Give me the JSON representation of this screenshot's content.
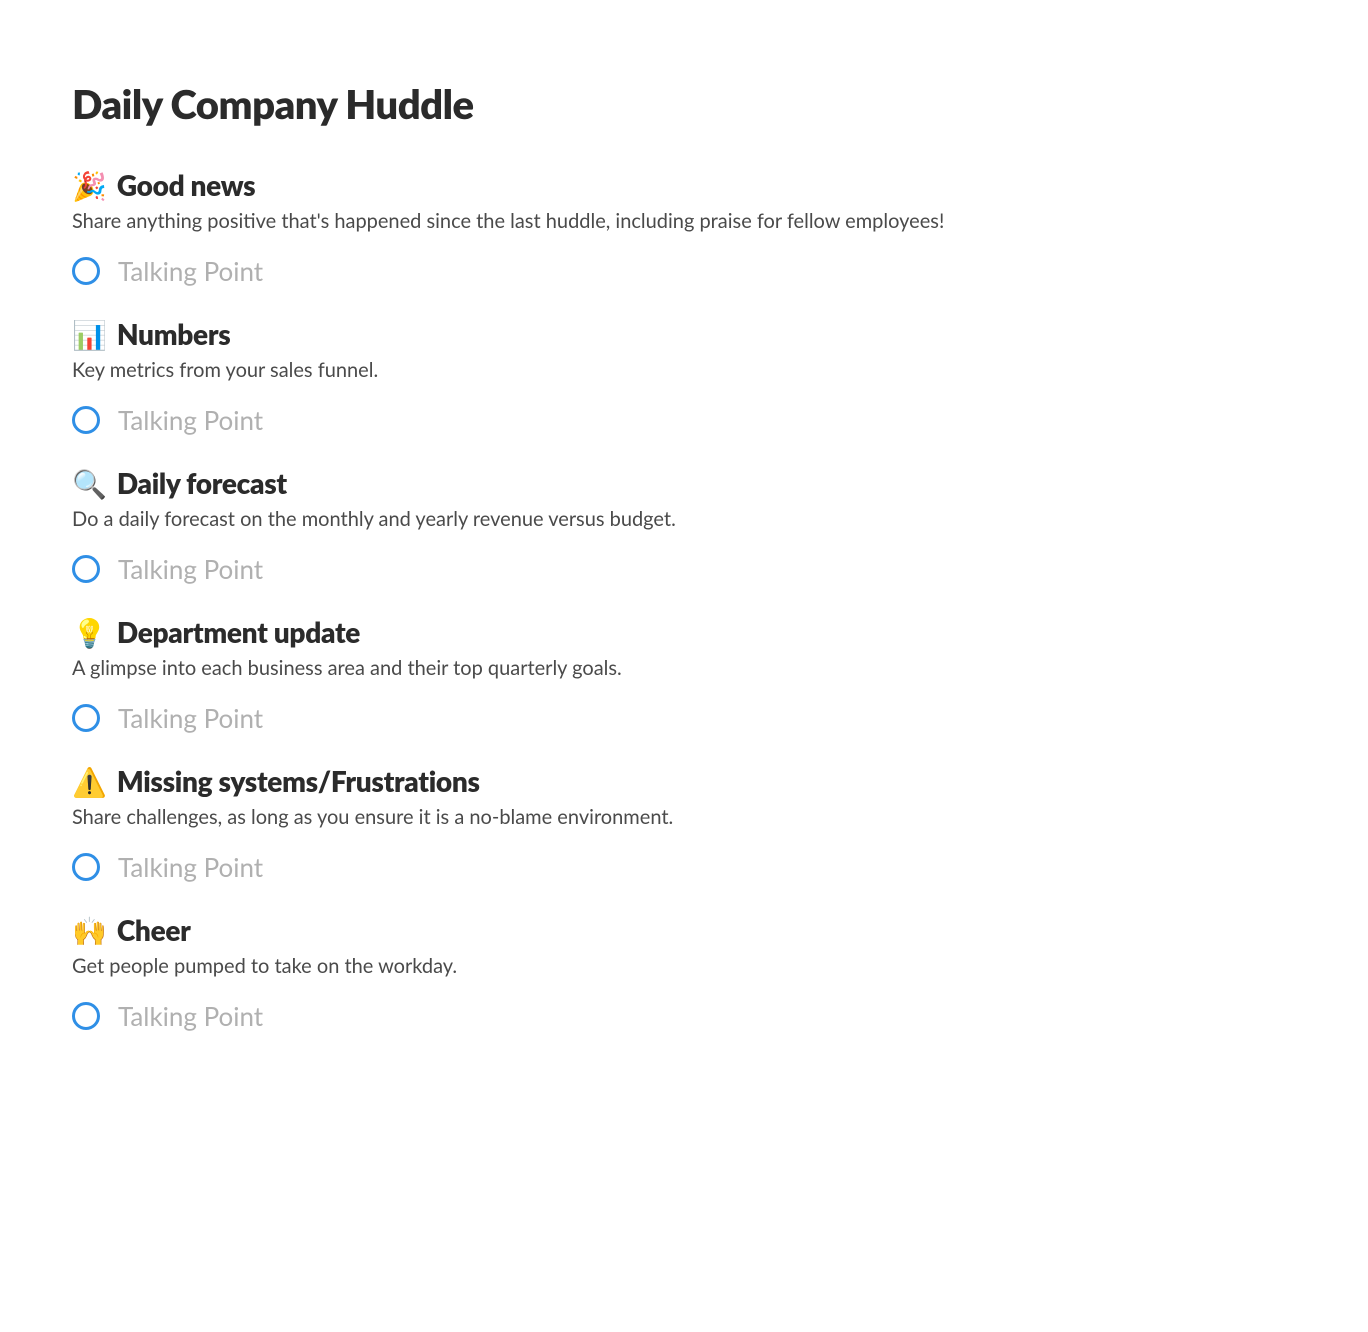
{
  "title": "Daily Company Huddle",
  "talking_point_placeholder": "Talking Point",
  "sections": [
    {
      "emoji": "🎉",
      "title": "Good news",
      "desc": "Share anything positive that's happened since the last huddle, including praise for fellow employees!"
    },
    {
      "emoji": "📊",
      "title": "Numbers",
      "desc": "Key metrics from your sales funnel."
    },
    {
      "emoji": "🔍",
      "title": "Daily forecast",
      "desc": "Do a daily forecast on the monthly and yearly revenue versus budget."
    },
    {
      "emoji": "💡",
      "title": "Department update",
      "desc": "A glimpse into each business area and their top quarterly goals."
    },
    {
      "emoji": "⚠️",
      "title": "Missing systems/Frustrations",
      "desc": "Share challenges, as long as you ensure it is a no-blame environment."
    },
    {
      "emoji": "🙌",
      "title": "Cheer",
      "desc": "Get people pumped to take on the workday."
    }
  ]
}
